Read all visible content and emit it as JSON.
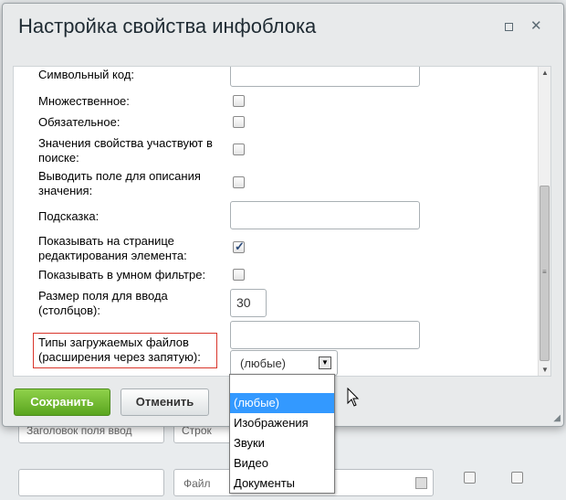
{
  "background": {
    "field1": "Заголовок поля ввод",
    "field2": "Строк",
    "field3": "Файл"
  },
  "dialog": {
    "title": "Настройка свойства инфоблока",
    "save_label": "Сохранить",
    "cancel_label": "Отменить"
  },
  "form": {
    "symbol_code": "Символьный код:",
    "multiple": "Множественное:",
    "required": "Обязательное:",
    "search_l1": "Значения свойства участвуют в",
    "search_l2": "поиске:",
    "desc_l1": "Выводить поле для описания",
    "desc_l2": "значения:",
    "hint": "Подсказка:",
    "show_l1": "Показывать на странице",
    "show_l2": "редактирования элемента:",
    "smart_filter": "Показывать в умном фильтре:",
    "size_l1": "Размер поля для ввода",
    "size_l2": "(столбцов):",
    "size_value": "30",
    "types_l1": "Типы загружаемых файлов",
    "types_l2": "(расширения через запятую):",
    "select_value": "(любые)"
  },
  "dropdown_options": [
    "(любые)",
    "Изображения",
    "Звуки",
    "Видео",
    "Документы"
  ],
  "colors": {
    "accent_selected": "#3399ff",
    "save_button": "#6bb82a",
    "highlight_border": "#d9352b"
  }
}
